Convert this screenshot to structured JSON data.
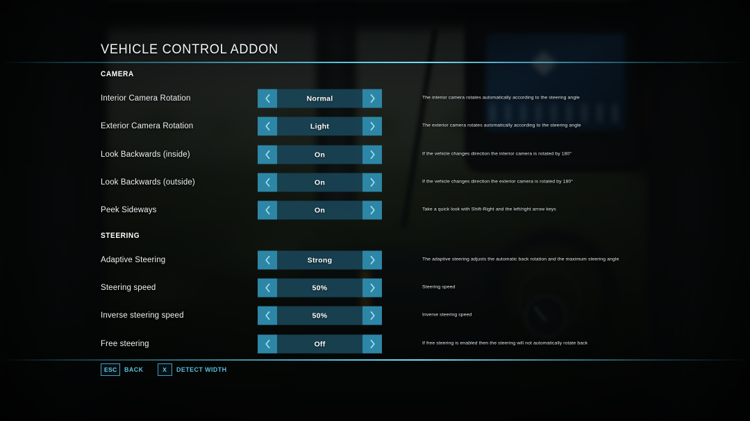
{
  "header": {
    "title": "VEHICLE CONTROL ADDON"
  },
  "sections": [
    {
      "heading": "CAMERA",
      "rows": [
        {
          "label": "Interior Camera Rotation",
          "value": "Normal",
          "description": "The interior camera rotates automatically according to the steering angle"
        },
        {
          "label": "Exterior Camera Rotation",
          "value": "Light",
          "description": "The exterior camera rotates automatically according to the steering angle"
        },
        {
          "label": "Look Backwards (inside)",
          "value": "On",
          "description": "If the vehicle changes direction the interior camera is rotated by 180°"
        },
        {
          "label": "Look Backwards (outside)",
          "value": "On",
          "description": "If the vehicle changes direction the exterior camera is rotated by 180°"
        },
        {
          "label": "Peek Sideways",
          "value": "On",
          "description": "Take a quick look with Shift-Right and the left/right arrow keys"
        }
      ]
    },
    {
      "heading": "STEERING",
      "rows": [
        {
          "label": "Adaptive Steering",
          "value": "Strong",
          "description": "The adaptive steering adjusts the automatic back rotation and the maximum steering angle"
        },
        {
          "label": "Steering speed",
          "value": "50%",
          "description": "Steering speed"
        },
        {
          "label": "Inverse steering speed",
          "value": "50%",
          "description": "Inverse steering speed"
        },
        {
          "label": "Free steering",
          "value": "Off",
          "description": "If free steering is enabled then the steering will not automatically rotate back"
        }
      ]
    }
  ],
  "footer": {
    "hints": [
      {
        "key": "ESC",
        "label": "BACK"
      },
      {
        "key": "X",
        "label": "DETECT WIDTH"
      }
    ]
  },
  "icons": {
    "prev": "chevron-left-icon",
    "next": "chevron-right-icon"
  },
  "colors": {
    "accent": "#5dbfe0",
    "arrow_button": "#2e86a6",
    "selector_body": "#1f4f61",
    "rule": "#78dcf5",
    "text": "#eef3f4"
  },
  "layout": {
    "section_tops": [
      101,
      334
    ],
    "row_tops": [
      128,
      168,
      209,
      249,
      289,
      361,
      401,
      441,
      482
    ]
  }
}
